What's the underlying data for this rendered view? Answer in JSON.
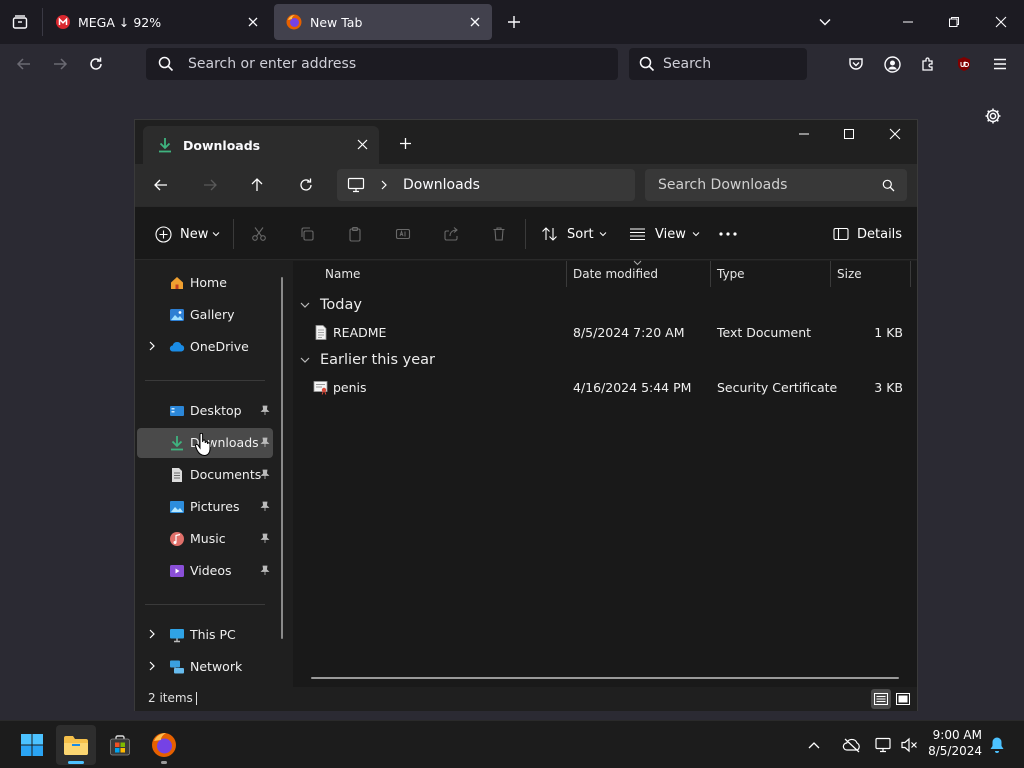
{
  "browser": {
    "tabs": [
      {
        "label": "MEGA ↓ 92%",
        "active": false
      },
      {
        "label": "New Tab",
        "active": true
      }
    ],
    "url_placeholder": "Search or enter address",
    "search_placeholder": "Search"
  },
  "explorer": {
    "tab_title": "Downloads",
    "breadcrumb": "Downloads",
    "search_placeholder": "Search Downloads",
    "toolbar": {
      "new_label": "New",
      "sort_label": "Sort",
      "view_label": "View",
      "details_label": "Details"
    },
    "nav": {
      "home": "Home",
      "gallery": "Gallery",
      "onedrive": "OneDrive",
      "desktop": "Desktop",
      "downloads": "Downloads",
      "documents": "Documents",
      "pictures": "Pictures",
      "music": "Music",
      "videos": "Videos",
      "thispc": "This PC",
      "network": "Network"
    },
    "columns": {
      "name": "Name",
      "date": "Date modified",
      "type": "Type",
      "size": "Size"
    },
    "groups": [
      {
        "title": "Today",
        "files": [
          {
            "name": "README",
            "date": "8/5/2024 7:20 AM",
            "type": "Text Document",
            "size": "1 KB"
          }
        ]
      },
      {
        "title": "Earlier this year",
        "files": [
          {
            "name": "penis",
            "date": "4/16/2024 5:44 PM",
            "type": "Security Certificate",
            "size": "3 KB"
          }
        ]
      }
    ],
    "status": "2 items"
  },
  "taskbar": {
    "time": "9:00 AM",
    "date": "8/5/2024"
  },
  "colors": {
    "accent": "#0078d4",
    "ff_tab_active": "#42414d",
    "explorer_bg": "#191919"
  }
}
